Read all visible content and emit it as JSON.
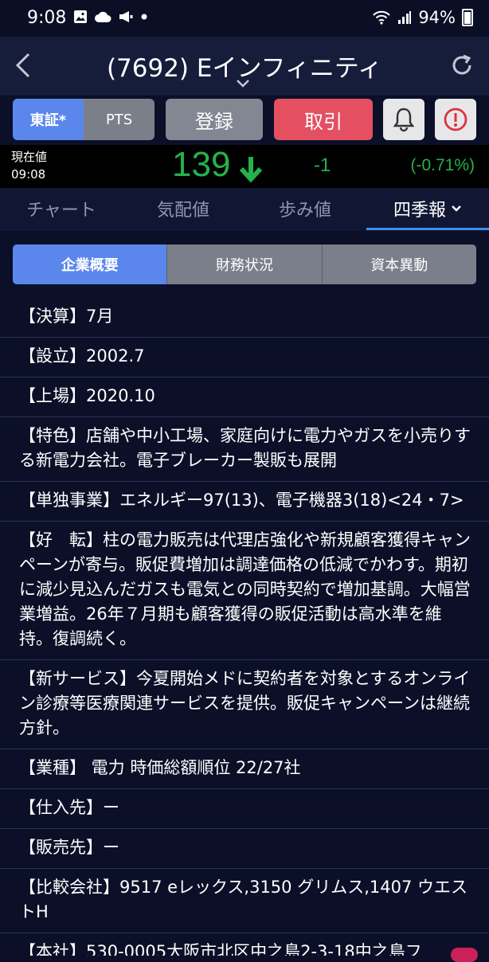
{
  "status_bar": {
    "time": "9:08",
    "battery": "94%",
    "icons": [
      "image-icon",
      "cloud-icon",
      "megaphone-icon",
      "dot-icon",
      "wifi-icon",
      "signal-icon",
      "battery-icon"
    ]
  },
  "header": {
    "title": "(7692) Eインフィニティ"
  },
  "buttons": {
    "market_tse": "東証*",
    "market_pts": "PTS",
    "register": "登録",
    "trade": "取引"
  },
  "price": {
    "label_line1": "現在値",
    "label_line2": "09:08",
    "value": "139",
    "change": "-1",
    "change_pct": "(-0.71%)",
    "color": "#25b24a"
  },
  "tabs": [
    {
      "label": "チャート"
    },
    {
      "label": "気配値"
    },
    {
      "label": "歩み値"
    },
    {
      "label": "四季報"
    }
  ],
  "subtabs": [
    {
      "label": "企業概要"
    },
    {
      "label": "財務状況"
    },
    {
      "label": "資本異動"
    }
  ],
  "rows": [
    "【決算】7月",
    "【設立】2002.7",
    "【上場】2020.10",
    "【特色】店舗や中小工場、家庭向けに電力やガスを小売りする新電力会社。電子ブレーカー製販も展開",
    "【単独事業】エネルギー97(13)、電子機器3(18)<24・7>",
    "【好　転】柱の電力販売は代理店強化や新規顧客獲得キャンペーンが寄与。販促費増加は調達価格の低減でかわす。期初に減少見込んだガスも電気との同時契約で増加基調。大幅営業増益。26年７月期も顧客獲得の販促活動は高水準を維持。復調続く。",
    "【新サービス】今夏開始メドに契約者を対象とするオンライン診療等医療関連サービスを提供。販促キャンペーンは継続方針。",
    "【業種】 電力 時価総額順位 22/27社",
    "【仕入先】ー",
    "【販売先】ー",
    "【比較会社】9517 eレックス,3150 グリムス,1407 ウエストH",
    "【本社】530-0005大阪市北区中之島2-3-18中之島フ"
  ],
  "colors": {
    "accent_blue": "#5b87ec",
    "trade_red": "#e54f62",
    "up_down_green": "#25b24a",
    "tab_underline": "#3e8ef0"
  }
}
